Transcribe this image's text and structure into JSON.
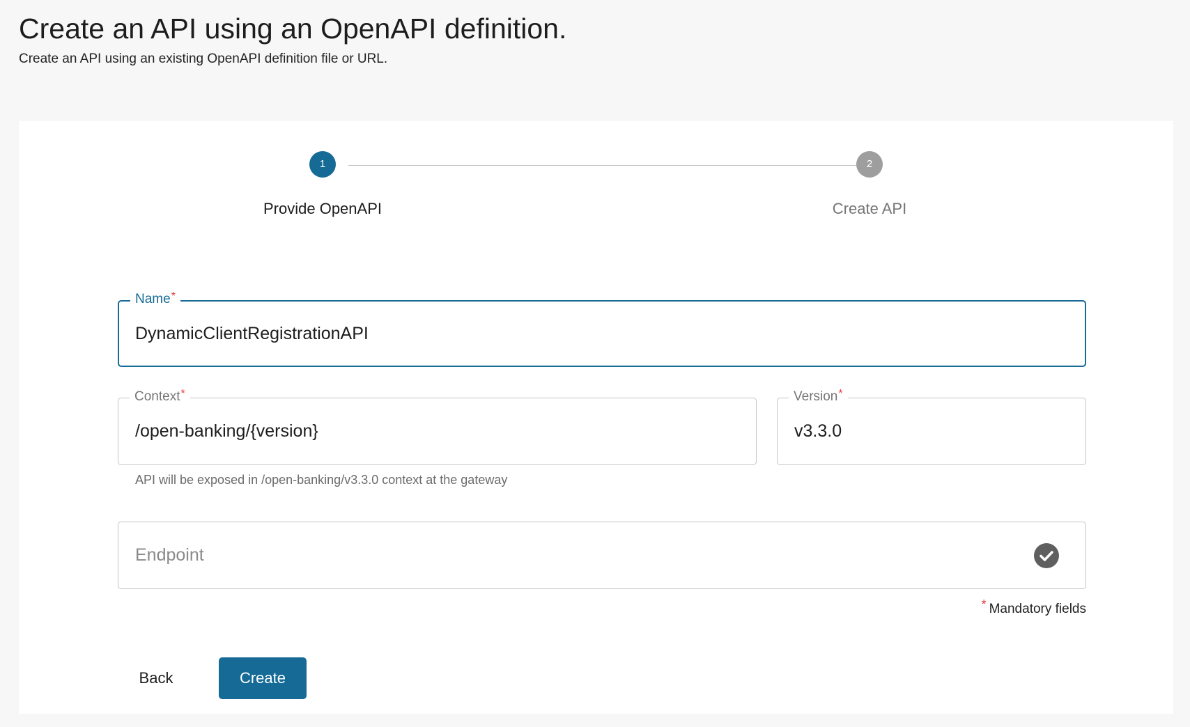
{
  "header": {
    "title": "Create an API using an OpenAPI definition.",
    "subtitle": "Create an API using an existing OpenAPI definition file or URL."
  },
  "stepper": {
    "steps": [
      {
        "number": "1",
        "label": "Provide OpenAPI",
        "state": "active"
      },
      {
        "number": "2",
        "label": "Create API",
        "state": "inactive"
      }
    ]
  },
  "form": {
    "name": {
      "label": "Name",
      "required_mark": "*",
      "value": "DynamicClientRegistrationAPI"
    },
    "context": {
      "label": "Context",
      "required_mark": "*",
      "value": "/open-banking/{version}"
    },
    "version": {
      "label": "Version",
      "required_mark": "*",
      "value": "v3.3.0"
    },
    "context_helper": "API will be exposed in /open-banking/v3.3.0 context at the gateway",
    "endpoint": {
      "placeholder": "Endpoint",
      "value": "",
      "status_icon": "check-circle-icon"
    },
    "mandatory_note": {
      "mark": "*",
      "text": "Mandatory fields"
    }
  },
  "actions": {
    "back_label": "Back",
    "create_label": "Create"
  },
  "colors": {
    "primary": "#156a96",
    "inactive_step": "#9e9e9e",
    "required": "#e53935",
    "background": "#f7f7f7"
  }
}
